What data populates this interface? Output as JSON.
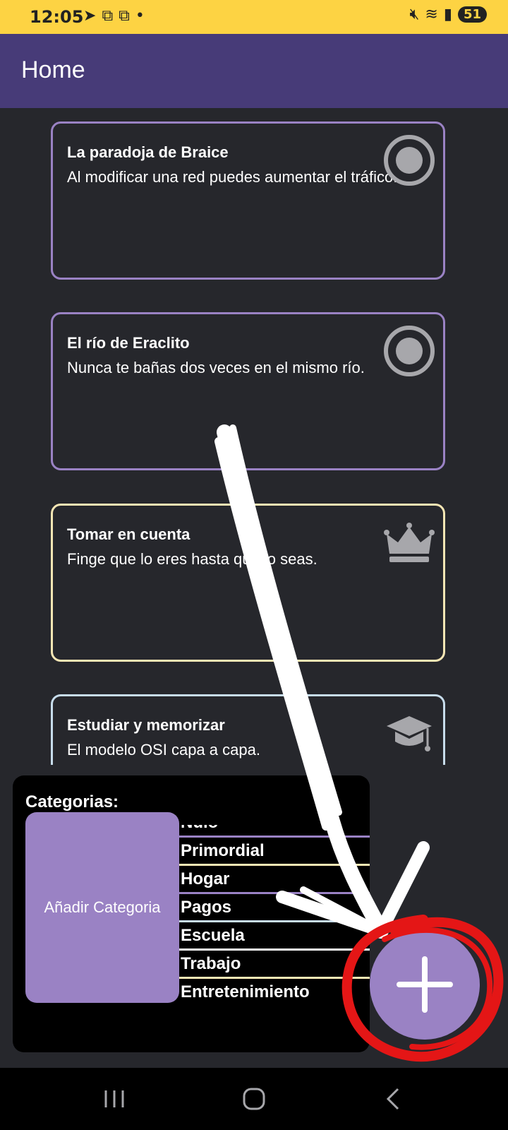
{
  "status_bar": {
    "time": "12:05",
    "battery": "51",
    "icons": [
      "telegram-icon",
      "youtube-icon",
      "youtube-icon",
      "dot-icon",
      "mute-icon",
      "wifi-icon",
      "signal-icon"
    ]
  },
  "app_bar": {
    "title": "Home"
  },
  "cards": [
    {
      "title": "La paradoja de Braice",
      "text": "Al modificar una red puedes aumentar el tráfico.",
      "icon": "radio-circle-icon",
      "border_color": "#9a82c4"
    },
    {
      "title": "El río de Eraclito",
      "text": "Nunca te bañas dos veces en el mismo río.",
      "icon": "radio-circle-icon",
      "border_color": "#9a82c4"
    },
    {
      "title": "Tomar en cuenta",
      "text": "Finge que lo eres hasta que lo seas.",
      "icon": "crown-icon",
      "border_color": "#f6e6b4"
    },
    {
      "title": "Estudiar y memorizar",
      "text": "El modelo OSI capa a capa.",
      "icon": "graduation-cap-icon",
      "border_color": "#c7dceb"
    }
  ],
  "categories_panel": {
    "label": "Categorias:",
    "add_button": "Añadir Categoria",
    "items": [
      {
        "label": "Nulo",
        "color": "#9a82c4"
      },
      {
        "label": "Primordial",
        "color": "#f6e6b4"
      },
      {
        "label": "Hogar",
        "color": "#9a82c4"
      },
      {
        "label": "Pagos",
        "color": "#c7dceb"
      },
      {
        "label": "Escuela",
        "color": "#ffffff"
      },
      {
        "label": "Trabajo",
        "color": "#f6e6b4"
      },
      {
        "label": "Entretenimiento",
        "color": "#9a82c4"
      }
    ]
  },
  "fab": {
    "icon": "plus-icon"
  },
  "nav_bar": {
    "icons": [
      "recents-icon",
      "home-icon",
      "back-icon"
    ]
  },
  "colors": {
    "accent": "#9a82c4",
    "app_bar": "#473b78",
    "background": "#26272c",
    "status_bar": "#fdd343"
  }
}
